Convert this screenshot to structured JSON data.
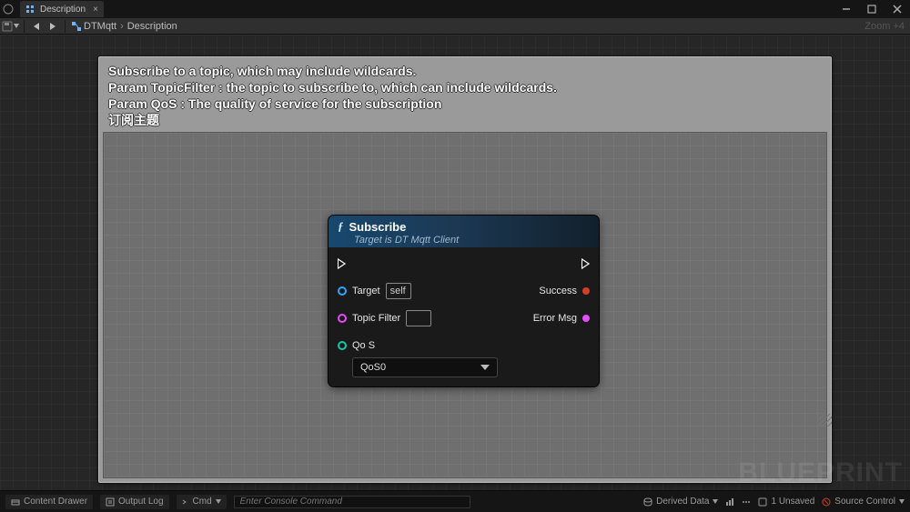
{
  "titlebar": {
    "tab_label": "Description"
  },
  "toolbar": {
    "breadcrumb_root": "DTMqtt",
    "breadcrumb_leaf": "Description",
    "zoom_label": "Zoom +4"
  },
  "comment": {
    "line1": "Subscribe to a topic, which may include wildcards.",
    "line2": "Param TopicFilter : the topic to subscribe to, which can include wildcards.",
    "line3": "Param QoS : The quality of service for the subscription",
    "line4": "订阅主题"
  },
  "node": {
    "title": "Subscribe",
    "subtitle": "Target is DT Mqtt Client",
    "inputs": {
      "target_label": "Target",
      "target_value": "self",
      "topic_filter_label": "Topic Filter",
      "qos_label": "Qo S",
      "qos_value": "QoS0"
    },
    "outputs": {
      "success_label": "Success",
      "error_msg_label": "Error Msg"
    }
  },
  "watermark": "BLUEPRINT",
  "statusbar": {
    "content_drawer": "Content Drawer",
    "output_log": "Output Log",
    "cmd_label": "Cmd",
    "cmd_placeholder": "Enter Console Command",
    "derived_data": "Derived Data",
    "unsaved": "1 Unsaved",
    "source_control": "Source Control"
  }
}
